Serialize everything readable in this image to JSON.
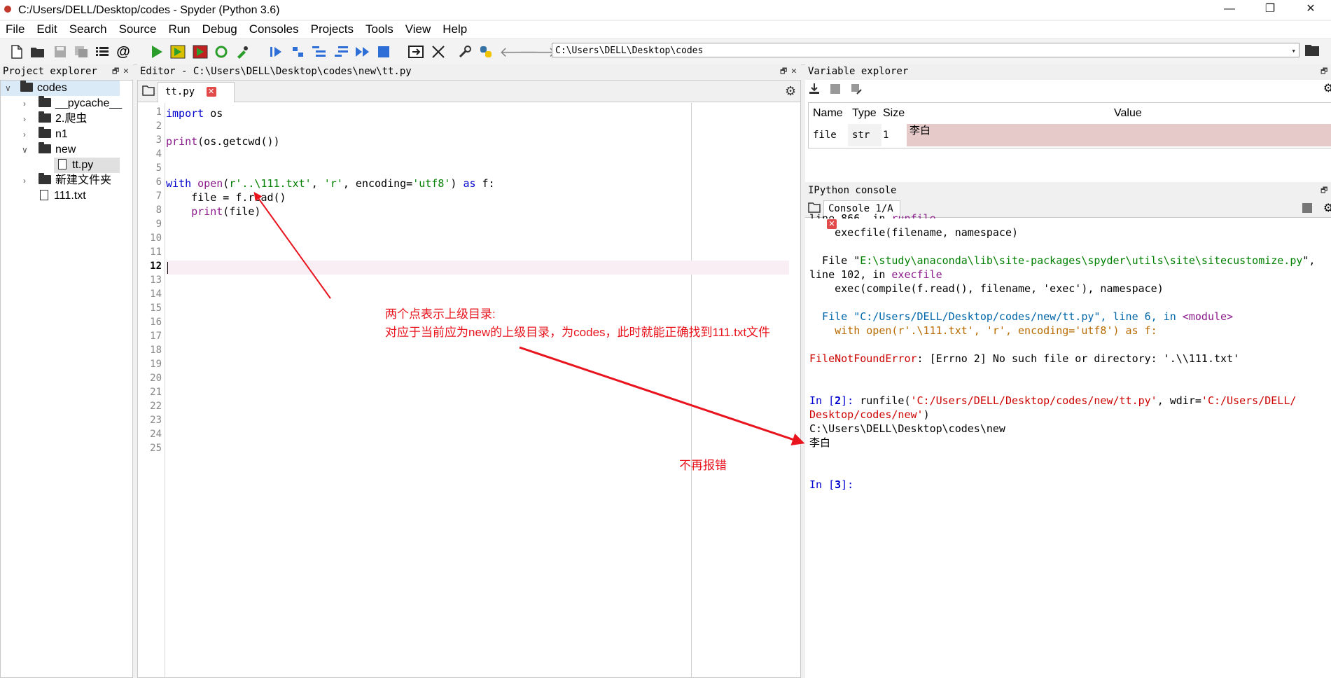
{
  "window": {
    "title": "C:/Users/DELL/Desktop/codes - Spyder (Python 3.6)",
    "min": "—",
    "max": "❐",
    "close": "✕"
  },
  "menu": [
    "File",
    "Edit",
    "Search",
    "Source",
    "Run",
    "Debug",
    "Consoles",
    "Projects",
    "Tools",
    "View",
    "Help"
  ],
  "toolbar": {
    "path": "C:\\Users\\DELL\\Desktop\\codes"
  },
  "project_explorer": {
    "title": "Project explorer",
    "items": [
      {
        "label": "codes",
        "type": "folder",
        "expanded": true
      },
      {
        "label": "__pycache__",
        "type": "folder"
      },
      {
        "label": "2.爬虫",
        "type": "folder"
      },
      {
        "label": "n1",
        "type": "folder"
      },
      {
        "label": "new",
        "type": "folder",
        "expanded": true
      },
      {
        "label": "tt.py",
        "type": "file"
      },
      {
        "label": "新建文件夹",
        "type": "folder"
      },
      {
        "label": "111.txt",
        "type": "file"
      }
    ]
  },
  "editor": {
    "title": "Editor - C:\\Users\\DELL\\Desktop\\codes\\new\\tt.py",
    "tab": "tt.py",
    "line_numbers": [
      "1",
      "2",
      "3",
      "4",
      "5",
      "6",
      "7",
      "8",
      "9",
      "10",
      "11",
      "12",
      "13",
      "14",
      "15",
      "16",
      "17",
      "18",
      "19",
      "20",
      "21",
      "22",
      "23",
      "24",
      "25"
    ],
    "code": {
      "l1_kw": "import",
      "l1_rest": " os",
      "l3_fn": "print",
      "l3_rest": "(os.getcwd())",
      "l6_kw": "with",
      "l6_sp": " ",
      "l6_open": "open",
      "l6_p": "(",
      "l6_s1": "r'..\\111.txt'",
      "l6_c1": ", ",
      "l6_s2": "'r'",
      "l6_c2": ", encoding=",
      "l6_s3": "'utf8'",
      "l6_c3": ") ",
      "l6_as": "as",
      "l6_end": " f:",
      "l7": "    file = f.read()",
      "l8_ind": "    ",
      "l8_fn": "print",
      "l8_rest": "(file)"
    }
  },
  "variable_explorer": {
    "title": "Variable explorer",
    "columns": [
      "Name",
      "Type",
      "Size",
      "Value"
    ],
    "rows": [
      {
        "name": "file",
        "type": "str",
        "size": "1",
        "value": "李白"
      }
    ],
    "value_bg": "#e6c9c9"
  },
  "ipython": {
    "title": "IPython console",
    "tab": "Console 1/A",
    "lines": {
      "c0a": "line 866, in ",
      "c0b": "runfile",
      "c1": "    execfile(filename, namespace)",
      "c2a": "  File \"",
      "c2b": "E:\\study\\anaconda\\lib\\site-packages\\spyder\\utils\\site\\sitecustomize.py",
      "c2c": "\",",
      "c3a": "line 102, in ",
      "c3b": "execfile",
      "c4": "    exec(compile(f.read(), filename, 'exec'), namespace)",
      "c5a": "  File \"",
      "c5b": "C:/Users/DELL/Desktop/codes/new/tt.py",
      "c5c": "\", line 6, in ",
      "c5d": "<module>",
      "c6a": "    with open(r'.\\111.txt', 'r', encoding='utf8') as f:",
      "c7a": "FileNotFoundError",
      "c7b": ": [Errno 2] No such file or directory: '.\\\\111.txt'",
      "c8a": "In [",
      "c8b": "2",
      "c8c": "]: ",
      "c8d": "runfile(",
      "c8e": "'C:/Users/DELL/Desktop/codes/new/tt.py'",
      "c8f": ", wdir=",
      "c8g": "'C:/Users/DELL/",
      "c9a": "Desktop/codes/new'",
      "c9b": ")",
      "c10": "C:\\Users\\DELL\\Desktop\\codes\\new",
      "c11": "李白",
      "c12a": "In [",
      "c12b": "3",
      "c12c": "]:"
    }
  },
  "annotations": {
    "note1_line1": "两个点表示上级目录:",
    "note1_line2": "对应于当前应为new的上级目录，为codes，此时就能正确找到111.txt文件",
    "note2": "不再报错",
    "color": "#e8141e"
  }
}
